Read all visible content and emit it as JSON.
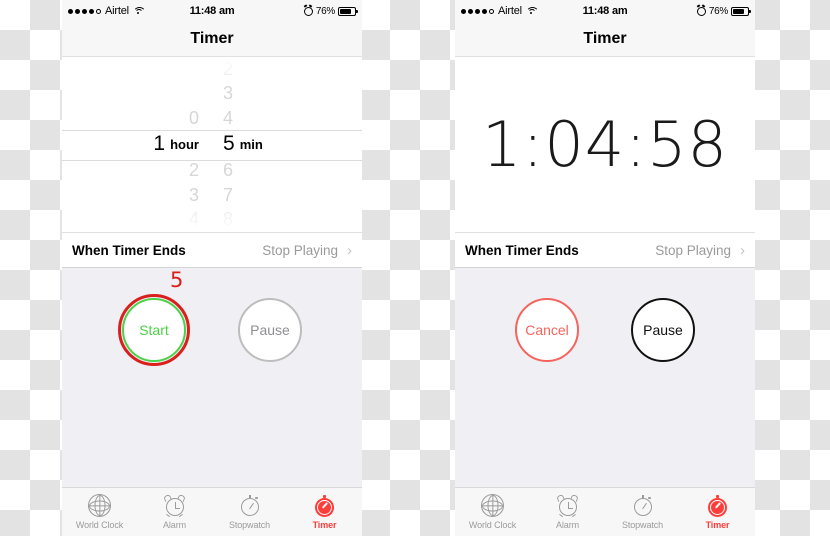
{
  "status_bar": {
    "signal_dots_filled": 4,
    "signal_dots_total": 5,
    "carrier": "Airtel",
    "wifi_icon": "wifi-icon",
    "time": "11:48 am",
    "alarm_icon": "alarm-clock-icon",
    "battery_percent": "76%",
    "battery_level": 75
  },
  "nav": {
    "title": "Timer"
  },
  "left_screen": {
    "picker": {
      "hours": {
        "above": [
          "",
          "",
          "0"
        ],
        "selected_value": "1",
        "selected_unit": "hour",
        "below": [
          "2",
          "3",
          "4"
        ]
      },
      "minutes": {
        "above": [
          "2",
          "3",
          "4"
        ],
        "selected_value": "5",
        "selected_unit": "min",
        "below": [
          "6",
          "7",
          "8"
        ]
      }
    },
    "when_timer_ends": {
      "label": "When Timer Ends",
      "value": "Stop Playing",
      "chevron_icon": "chevron-right-icon"
    },
    "buttons": {
      "primary": {
        "label": "Start",
        "color": "#4cd248"
      },
      "secondary": {
        "label": "Pause",
        "color": "#8e8e93"
      }
    },
    "annotation": {
      "number": "5",
      "color": "#d9201c"
    }
  },
  "right_screen": {
    "countdown": "1:04:58",
    "when_timer_ends": {
      "label": "When Timer Ends",
      "value": "Stop Playing",
      "chevron_icon": "chevron-right-icon"
    },
    "buttons": {
      "primary": {
        "label": "Cancel",
        "color": "#f4645c"
      },
      "secondary": {
        "label": "Pause",
        "color": "#111111"
      }
    }
  },
  "tab_bar": {
    "items": [
      {
        "label": "World Clock",
        "icon": "globe-icon",
        "active": false
      },
      {
        "label": "Alarm",
        "icon": "alarm-clock-icon",
        "active": false
      },
      {
        "label": "Stopwatch",
        "icon": "stopwatch-icon",
        "active": false
      },
      {
        "label": "Timer",
        "icon": "timer-icon",
        "active": true
      }
    ],
    "active_color": "#fc3d39",
    "inactive_color": "#9b9b9b"
  }
}
